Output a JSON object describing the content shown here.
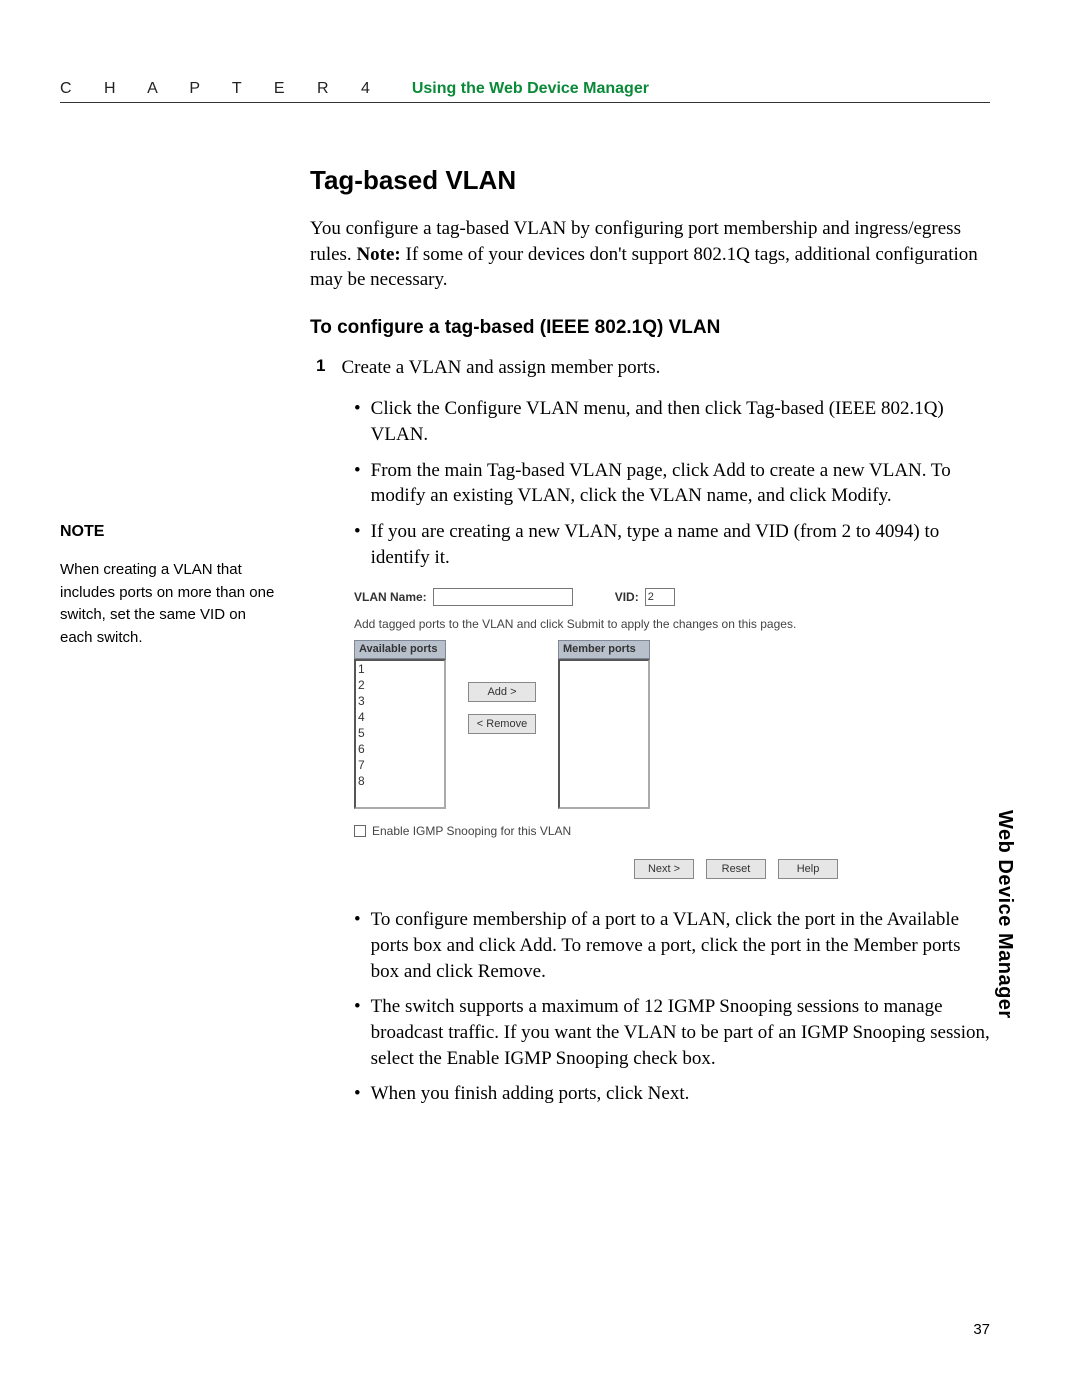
{
  "header": {
    "chapter": "C H A P T E R   4",
    "subtitle": "Using the Web Device Manager"
  },
  "side": {
    "note_title": "NOTE",
    "note_body": "When creating a VLAN that includes ports on more than one switch, set the same VID on each switch."
  },
  "main": {
    "h1": "Tag-based VLAN",
    "intro_a": "You configure a tag-based VLAN by configuring port membership and ingress/egress rules.  ",
    "intro_note_label": "Note:",
    "intro_b": " If some of your devices don't support 802.1Q tags, additional configuration may be necessary.",
    "h2": "To configure a tag-based (IEEE 802.1Q) VLAN",
    "step1_num": "1",
    "step1_text": "Create a VLAN and assign member ports.",
    "bullets_a": [
      "Click the Configure VLAN menu, and then click Tag-based (IEEE 802.1Q) VLAN.",
      "From the main Tag-based VLAN page, click Add to create a new VLAN. To modify an existing VLAN, click the VLAN name, and click Modify.",
      "If you are creating a new VLAN, type a name and VID (from 2 to 4094) to identify it."
    ],
    "bullets_b": [
      "To configure membership of a port to a VLAN, click the port in the Available ports box and click Add. To remove a port, click the port in the Member ports box and click Remove.",
      "The switch supports a maximum of 12 IGMP Snooping sessions to manage broadcast traffic. If you want the VLAN to be part of an IGMP Snooping session, select the Enable IGMP Snooping check box.",
      "When you finish adding ports, click Next."
    ]
  },
  "ui": {
    "vlan_name_label": "VLAN Name:",
    "vid_label": "VID:",
    "vid_value": "2",
    "desc": "Add tagged ports to the VLAN and click Submit to apply the changes on this pages.",
    "available_header": "Available ports",
    "member_header": "Member ports",
    "ports": [
      "1",
      "2",
      "3",
      "4",
      "5",
      "6",
      "7",
      "8"
    ],
    "add_btn": "Add >",
    "remove_btn": "< Remove",
    "igmp_label": "Enable IGMP Snooping for this VLAN",
    "next_btn": "Next >",
    "reset_btn": "Reset",
    "help_btn": "Help"
  },
  "side_tab": "Web Device Manager",
  "page_num": "37"
}
